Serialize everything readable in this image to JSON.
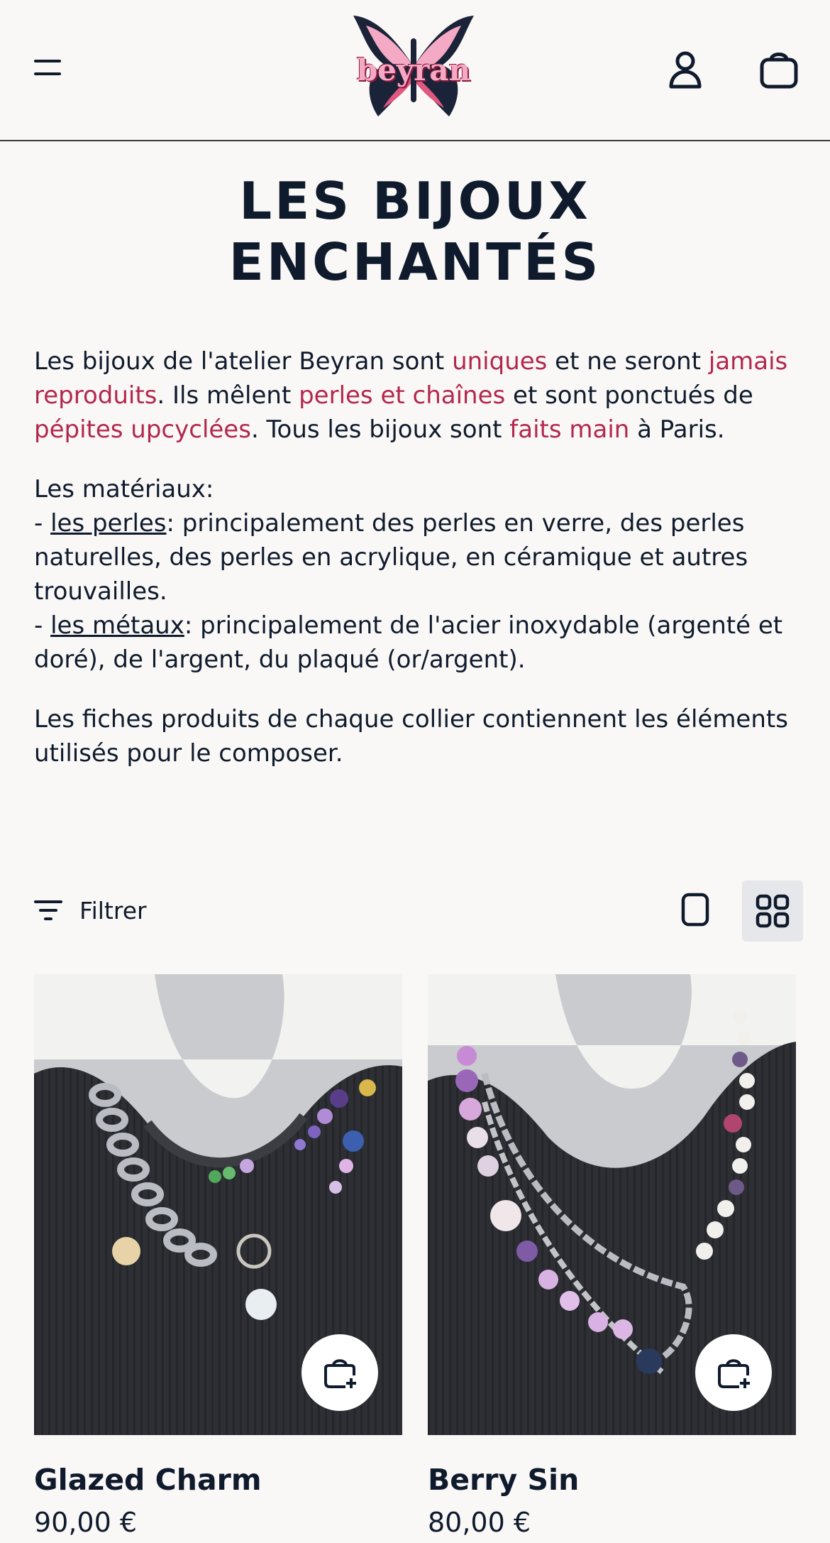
{
  "header": {
    "menu_icon": "hamburger-icon",
    "logo_text": "beyran",
    "account_icon": "user-icon",
    "cart_icon": "shopping-bag-icon"
  },
  "collection": {
    "title_line1": "LES BIJOUX",
    "title_line2": "ENCHANTÉS"
  },
  "description": {
    "p1": [
      {
        "text": "Les bijoux de l'atelier Beyran sont ",
        "hl": false
      },
      {
        "text": "uniques",
        "hl": true
      },
      {
        "text": " et ne seront ",
        "hl": false
      },
      {
        "text": "jamais reproduits",
        "hl": true
      },
      {
        "text": ". Ils mêlent ",
        "hl": false
      },
      {
        "text": "perles et chaînes",
        "hl": true
      },
      {
        "text": " et sont ponctués de ",
        "hl": false
      },
      {
        "text": "pépites upcyclées",
        "hl": true
      },
      {
        "text": ". Tous les bijoux sont ",
        "hl": false
      },
      {
        "text": "faits main",
        "hl": true
      },
      {
        "text": " à Paris.",
        "hl": false
      }
    ],
    "materials_heading": "Les matériaux:",
    "dash": "- ",
    "perles_label": "les perles",
    "perles_text": ": principalement des perles en verre, des perles naturelles, des perles en acrylique, en céramique et autres trouvailles.",
    "metaux_label": "les métaux",
    "metaux_text": ": principalement de l'acier inoxydable (argenté et doré), de l'argent, du plaqué (or/argent).",
    "p3": "Les fiches produits de chaque collier contiennent les éléments utilisés pour le composer."
  },
  "toolbar": {
    "filter_label": "Filtrer",
    "filter_icon": "filter-lines-icon",
    "view_single_icon": "square-view-icon",
    "view_grid_icon": "grid-view-icon"
  },
  "products": [
    {
      "name": "Glazed Charm",
      "price": "90,00 €",
      "quick_add_icon": "bag-plus-icon"
    },
    {
      "name": "Berry Sin",
      "price": "80,00 €",
      "quick_add_icon": "bag-plus-icon"
    }
  ],
  "colors": {
    "background": "#faf8f6",
    "text": "#0f1b2d",
    "highlight": "#b3274e",
    "logo_pink": "#f4a9c4"
  }
}
